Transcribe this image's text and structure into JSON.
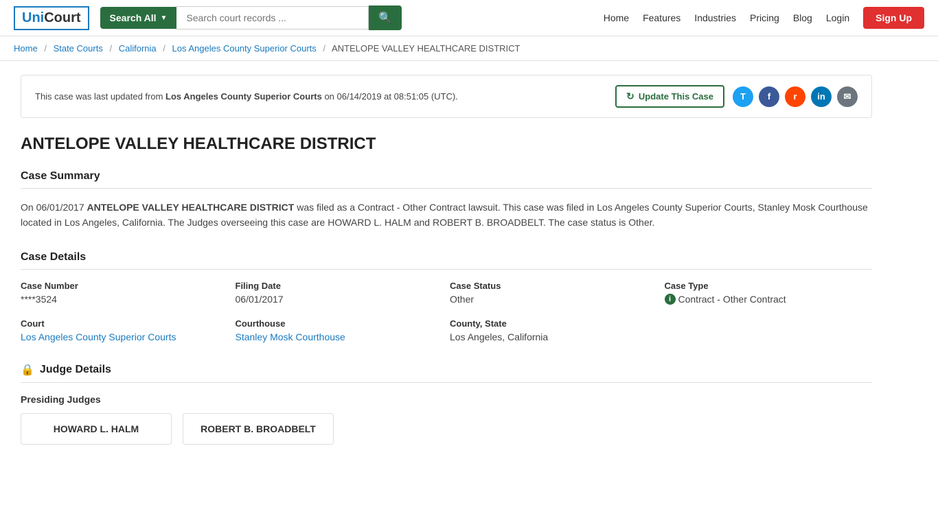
{
  "header": {
    "logo_uni": "Uni",
    "logo_court": "Court",
    "search_all_label": "Search All",
    "search_placeholder": "Search court records ...",
    "nav_home": "Home",
    "nav_features": "Features",
    "nav_industries": "Industries",
    "nav_pricing": "Pricing",
    "nav_blog": "Blog",
    "nav_login": "Login",
    "nav_signup": "Sign Up"
  },
  "breadcrumb": {
    "home": "Home",
    "state_courts": "State Courts",
    "california": "California",
    "la_courts": "Los Angeles County Superior Courts",
    "current": "ANTELOPE VALLEY HEALTHCARE DISTRICT"
  },
  "banner": {
    "text_pre": "This case was last updated from",
    "court_name": "Los Angeles County Superior Courts",
    "text_post": "on 06/14/2019 at 08:51:05 (UTC).",
    "update_btn": "Update This Case"
  },
  "case_title": "ANTELOPE VALLEY HEALTHCARE DISTRICT",
  "case_summary": {
    "section_label": "Case Summary",
    "text_pre": "On 06/01/2017",
    "party_name": "ANTELOPE VALLEY HEALTHCARE DISTRICT",
    "text_post": "was filed as a Contract - Other Contract lawsuit. This case was filed in Los Angeles County Superior Courts, Stanley Mosk Courthouse located in Los Angeles, California. The Judges overseeing this case are HOWARD L. HALM and ROBERT B. BROADBELT. The case status is Other."
  },
  "case_details": {
    "section_label": "Case Details",
    "case_number_label": "Case Number",
    "case_number_value": "****3524",
    "filing_date_label": "Filing Date",
    "filing_date_value": "06/01/2017",
    "case_status_label": "Case Status",
    "case_status_value": "Other",
    "case_type_label": "Case Type",
    "case_type_value": "Contract - Other Contract",
    "court_label": "Court",
    "court_value": "Los Angeles County Superior Courts",
    "courthouse_label": "Courthouse",
    "courthouse_value": "Stanley Mosk Courthouse",
    "county_state_label": "County, State",
    "county_state_value": "Los Angeles, California"
  },
  "judge_details": {
    "section_label": "Judge Details",
    "presiding_label": "Presiding Judges",
    "judge1": "HOWARD L. HALM",
    "judge2": "ROBERT B. BROADBELT"
  },
  "share": {
    "twitter": "T",
    "facebook": "f",
    "reddit": "r",
    "linkedin": "in",
    "email": "✉"
  }
}
